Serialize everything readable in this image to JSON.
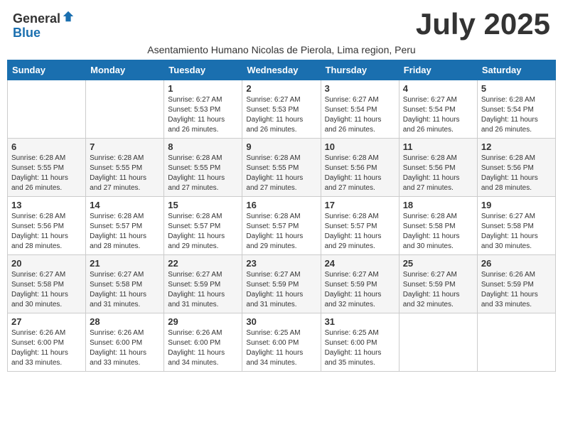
{
  "header": {
    "logo_general": "General",
    "logo_blue": "Blue",
    "month_title": "July 2025",
    "subtitle": "Asentamiento Humano Nicolas de Pierola, Lima region, Peru"
  },
  "weekdays": [
    "Sunday",
    "Monday",
    "Tuesday",
    "Wednesday",
    "Thursday",
    "Friday",
    "Saturday"
  ],
  "weeks": [
    [
      {
        "day": "",
        "info": ""
      },
      {
        "day": "",
        "info": ""
      },
      {
        "day": "1",
        "info": "Sunrise: 6:27 AM\nSunset: 5:53 PM\nDaylight: 11 hours and 26 minutes."
      },
      {
        "day": "2",
        "info": "Sunrise: 6:27 AM\nSunset: 5:53 PM\nDaylight: 11 hours and 26 minutes."
      },
      {
        "day": "3",
        "info": "Sunrise: 6:27 AM\nSunset: 5:54 PM\nDaylight: 11 hours and 26 minutes."
      },
      {
        "day": "4",
        "info": "Sunrise: 6:27 AM\nSunset: 5:54 PM\nDaylight: 11 hours and 26 minutes."
      },
      {
        "day": "5",
        "info": "Sunrise: 6:28 AM\nSunset: 5:54 PM\nDaylight: 11 hours and 26 minutes."
      }
    ],
    [
      {
        "day": "6",
        "info": "Sunrise: 6:28 AM\nSunset: 5:55 PM\nDaylight: 11 hours and 26 minutes."
      },
      {
        "day": "7",
        "info": "Sunrise: 6:28 AM\nSunset: 5:55 PM\nDaylight: 11 hours and 27 minutes."
      },
      {
        "day": "8",
        "info": "Sunrise: 6:28 AM\nSunset: 5:55 PM\nDaylight: 11 hours and 27 minutes."
      },
      {
        "day": "9",
        "info": "Sunrise: 6:28 AM\nSunset: 5:55 PM\nDaylight: 11 hours and 27 minutes."
      },
      {
        "day": "10",
        "info": "Sunrise: 6:28 AM\nSunset: 5:56 PM\nDaylight: 11 hours and 27 minutes."
      },
      {
        "day": "11",
        "info": "Sunrise: 6:28 AM\nSunset: 5:56 PM\nDaylight: 11 hours and 27 minutes."
      },
      {
        "day": "12",
        "info": "Sunrise: 6:28 AM\nSunset: 5:56 PM\nDaylight: 11 hours and 28 minutes."
      }
    ],
    [
      {
        "day": "13",
        "info": "Sunrise: 6:28 AM\nSunset: 5:56 PM\nDaylight: 11 hours and 28 minutes."
      },
      {
        "day": "14",
        "info": "Sunrise: 6:28 AM\nSunset: 5:57 PM\nDaylight: 11 hours and 28 minutes."
      },
      {
        "day": "15",
        "info": "Sunrise: 6:28 AM\nSunset: 5:57 PM\nDaylight: 11 hours and 29 minutes."
      },
      {
        "day": "16",
        "info": "Sunrise: 6:28 AM\nSunset: 5:57 PM\nDaylight: 11 hours and 29 minutes."
      },
      {
        "day": "17",
        "info": "Sunrise: 6:28 AM\nSunset: 5:57 PM\nDaylight: 11 hours and 29 minutes."
      },
      {
        "day": "18",
        "info": "Sunrise: 6:28 AM\nSunset: 5:58 PM\nDaylight: 11 hours and 30 minutes."
      },
      {
        "day": "19",
        "info": "Sunrise: 6:27 AM\nSunset: 5:58 PM\nDaylight: 11 hours and 30 minutes."
      }
    ],
    [
      {
        "day": "20",
        "info": "Sunrise: 6:27 AM\nSunset: 5:58 PM\nDaylight: 11 hours and 30 minutes."
      },
      {
        "day": "21",
        "info": "Sunrise: 6:27 AM\nSunset: 5:58 PM\nDaylight: 11 hours and 31 minutes."
      },
      {
        "day": "22",
        "info": "Sunrise: 6:27 AM\nSunset: 5:59 PM\nDaylight: 11 hours and 31 minutes."
      },
      {
        "day": "23",
        "info": "Sunrise: 6:27 AM\nSunset: 5:59 PM\nDaylight: 11 hours and 31 minutes."
      },
      {
        "day": "24",
        "info": "Sunrise: 6:27 AM\nSunset: 5:59 PM\nDaylight: 11 hours and 32 minutes."
      },
      {
        "day": "25",
        "info": "Sunrise: 6:27 AM\nSunset: 5:59 PM\nDaylight: 11 hours and 32 minutes."
      },
      {
        "day": "26",
        "info": "Sunrise: 6:26 AM\nSunset: 5:59 PM\nDaylight: 11 hours and 33 minutes."
      }
    ],
    [
      {
        "day": "27",
        "info": "Sunrise: 6:26 AM\nSunset: 6:00 PM\nDaylight: 11 hours and 33 minutes."
      },
      {
        "day": "28",
        "info": "Sunrise: 6:26 AM\nSunset: 6:00 PM\nDaylight: 11 hours and 33 minutes."
      },
      {
        "day": "29",
        "info": "Sunrise: 6:26 AM\nSunset: 6:00 PM\nDaylight: 11 hours and 34 minutes."
      },
      {
        "day": "30",
        "info": "Sunrise: 6:25 AM\nSunset: 6:00 PM\nDaylight: 11 hours and 34 minutes."
      },
      {
        "day": "31",
        "info": "Sunrise: 6:25 AM\nSunset: 6:00 PM\nDaylight: 11 hours and 35 minutes."
      },
      {
        "day": "",
        "info": ""
      },
      {
        "day": "",
        "info": ""
      }
    ]
  ]
}
